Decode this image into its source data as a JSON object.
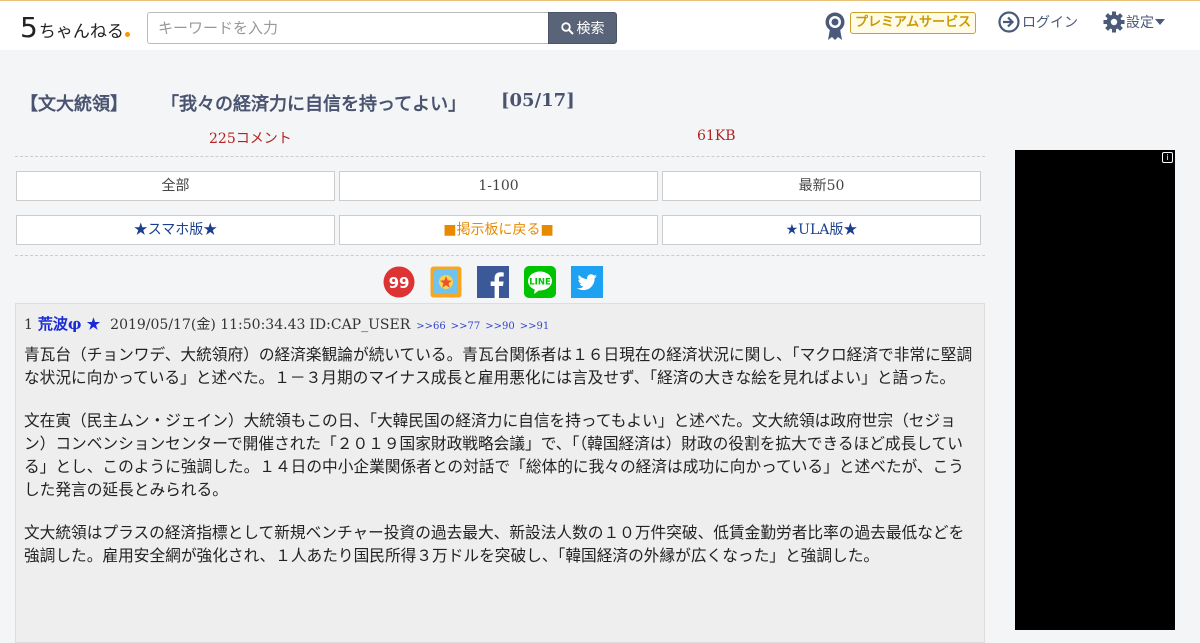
{
  "header": {
    "logo_number": "5",
    "logo_text": "ちゃんねる",
    "search_placeholder": "キーワードを入力",
    "search_button": "検索",
    "premium_label": "プレミアムサービス",
    "login_label": "ログイン",
    "settings_label": "設定"
  },
  "thread": {
    "title_tag": "【文大統領】",
    "title_quote": "「我々の経済力に自信を持ってよい」",
    "title_date": "[05/17]",
    "comment_count": "225コメント",
    "size": "61KB"
  },
  "nav": {
    "all": "全部",
    "range": "1-100",
    "latest": "最新50",
    "smartphone": "★スマホ版★",
    "back_to_board": "■掲示板に戻る■",
    "ula": "★ULA版★"
  },
  "share_icons": [
    "99-icon",
    "bookmark-icon",
    "facebook-icon",
    "line-icon",
    "twitter-icon"
  ],
  "post": {
    "number": "1",
    "name": "荒波φ ★",
    "date": "2019/05/17(金) 11:50:34.43",
    "id": "ID:CAP_USER",
    "replies": [
      ">>66",
      ">>77",
      ">>90",
      ">>91"
    ],
    "paragraphs": [
      "青瓦台（チョンワデ、大統領府）の経済楽観論が続いている。青瓦台関係者は１６日現在の経済状況に関し、「マクロ経済で非常に堅調な状況に向かっている」と述べた。１－３月期のマイナス成長と雇用悪化には言及せず、「経済の大きな絵を見ればよい」と語った。",
      "文在寅（民主ムン・ジェイン）大統領もこの日、「大韓民国の経済力に自信を持ってもよい」と述べた。文大統領は政府世宗（セジョン）コンベンションセンターで開催された「２０１９国家財政戦略会議」で、「（韓国経済は）財政の役割を拡大できるほど成長している」とし、このように強調した。１４日の中小企業関係者との対話で「総体的に我々の経済は成功に向かっている」と述べたが、こうした発言の延長とみられる。",
      "文大統領はプラスの経済指標として新規ベンチャー投資の過去最大、新設法人数の１０万件突破、低賃金勤労者比率の過去最低などを強調した。雇用安全網が強化され、１人あたり国民所得３万ドルを突破し、「韓国経済の外縁が広くなった」と強調した。"
    ]
  },
  "colors": {
    "accent_red": "#b22222",
    "link_blue": "#1b3f8f",
    "orange": "#e88a00",
    "search_button_bg": "#5a6478",
    "post_name": "#1a2bd6"
  }
}
